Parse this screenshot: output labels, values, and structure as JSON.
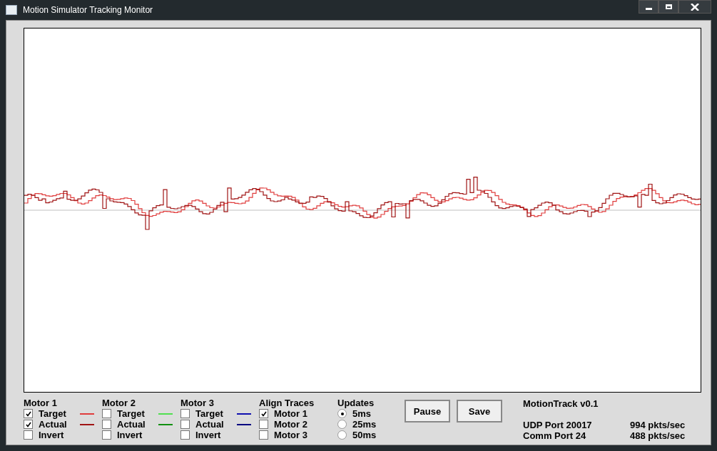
{
  "window": {
    "title": "Motion Simulator Tracking Monitor"
  },
  "motors": [
    {
      "name": "Motor 1",
      "options": [
        {
          "label": "Target",
          "checked": true,
          "color": "#e03c3c"
        },
        {
          "label": "Actual",
          "checked": true,
          "color": "#a01414"
        },
        {
          "label": "Invert",
          "checked": false
        }
      ]
    },
    {
      "name": "Motor 2",
      "options": [
        {
          "label": "Target",
          "checked": false,
          "color": "#50e050"
        },
        {
          "label": "Actual",
          "checked": false,
          "color": "#109010"
        },
        {
          "label": "Invert",
          "checked": false
        }
      ]
    },
    {
      "name": "Motor 3",
      "options": [
        {
          "label": "Target",
          "checked": false,
          "color": "#1010b0"
        },
        {
          "label": "Actual",
          "checked": false,
          "color": "#000080"
        },
        {
          "label": "Invert",
          "checked": false
        }
      ]
    }
  ],
  "align_traces": {
    "title": "Align Traces",
    "options": [
      {
        "label": "Motor 1",
        "checked": true
      },
      {
        "label": "Motor 2",
        "checked": false
      },
      {
        "label": "Motor 3",
        "checked": false
      }
    ]
  },
  "updates": {
    "title": "Updates",
    "options": [
      {
        "label": "5ms",
        "selected": true
      },
      {
        "label": "25ms",
        "selected": false
      },
      {
        "label": "50ms",
        "selected": false
      }
    ]
  },
  "buttons": [
    "Pause",
    "Save"
  ],
  "info": {
    "version": "MotionTrack v0.1",
    "rows": [
      {
        "port": "UDP Port 20017",
        "rate": "994 pkts/sec"
      },
      {
        "port": "Comm Port 24",
        "rate": "488 pkts/sec"
      }
    ]
  }
}
